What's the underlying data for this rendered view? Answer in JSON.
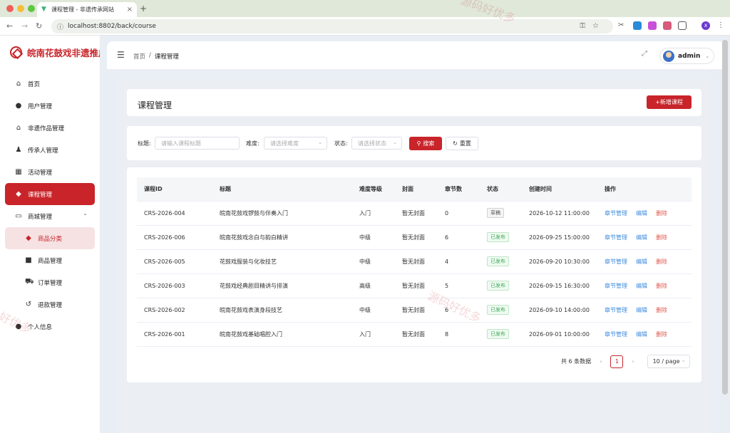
{
  "browser": {
    "tab_title": "课程管理 - 非遗传承网站",
    "new_tab": "+",
    "tab_close": "×",
    "url": "localhost:8802/back/course",
    "profile_initial": "x"
  },
  "sidebar": {
    "logo_text": "皖南花鼓戏非遗推广",
    "items": [
      {
        "label": "首页",
        "icon": "home-icon"
      },
      {
        "label": "用户管理",
        "icon": "user-icon"
      },
      {
        "label": "非遗作品管理",
        "icon": "bank-icon"
      },
      {
        "label": "传承人管理",
        "icon": "inheritor-icon"
      },
      {
        "label": "活动管理",
        "icon": "calendar-icon"
      },
      {
        "label": "课程管理",
        "icon": "graduation-cap-icon"
      },
      {
        "label": "商城管理",
        "icon": "shop-icon"
      }
    ],
    "sub_items": [
      {
        "label": "商品分类",
        "icon": "tag-icon"
      },
      {
        "label": "商品管理",
        "icon": "bag-icon"
      },
      {
        "label": "订单管理",
        "icon": "cart-icon"
      },
      {
        "label": "退款管理",
        "icon": "refund-icon"
      }
    ],
    "last_item": {
      "label": "个人信息",
      "icon": "profile-icon"
    }
  },
  "header": {
    "breadcrumb_home": "首页",
    "breadcrumb_sep": "/",
    "breadcrumb_current": "课程管理",
    "username": "admin"
  },
  "page": {
    "title": "课程管理",
    "add_button": "+新增课程"
  },
  "filters": {
    "title_label": "标题:",
    "title_placeholder": "请输入课程标题",
    "difficulty_label": "难度:",
    "difficulty_placeholder": "请选择难度",
    "status_label": "状态:",
    "status_placeholder": "请选择状态",
    "search_button": "搜索",
    "reset_button": "重置"
  },
  "table": {
    "headers": [
      "课程ID",
      "标题",
      "难度等级",
      "封面",
      "章节数",
      "状态",
      "创建时间",
      "操作"
    ],
    "rows": [
      {
        "id": "CRS-2026-004",
        "title": "皖南花鼓戏锣鼓与伴奏入门",
        "level": "入门",
        "cover": "暂无封面",
        "chapters": "0",
        "status": "草稿",
        "created": "2026-10-12 11:00:00"
      },
      {
        "id": "CRS-2026-006",
        "title": "皖南花鼓戏念白与韵白精讲",
        "level": "中级",
        "cover": "暂无封面",
        "chapters": "6",
        "status": "已发布",
        "created": "2026-09-25 15:00:00"
      },
      {
        "id": "CRS-2026-005",
        "title": "花鼓戏服装与化妆技艺",
        "level": "中级",
        "cover": "暂无封面",
        "chapters": "4",
        "status": "已发布",
        "created": "2026-09-20 10:30:00"
      },
      {
        "id": "CRS-2026-003",
        "title": "花鼓戏经典剧目精讲与排演",
        "level": "高级",
        "cover": "暂无封面",
        "chapters": "5",
        "status": "已发布",
        "created": "2026-09-15 16:30:00"
      },
      {
        "id": "CRS-2026-002",
        "title": "皖南花鼓戏表演身段技艺",
        "level": "中级",
        "cover": "暂无封面",
        "chapters": "6",
        "status": "已发布",
        "created": "2026-09-10 14:00:00"
      },
      {
        "id": "CRS-2026-001",
        "title": "皖南花鼓戏基础唱腔入门",
        "level": "入门",
        "cover": "暂无封面",
        "chapters": "8",
        "status": "已发布",
        "created": "2026-09-01 10:00:00"
      }
    ],
    "actions": {
      "chapters": "章节管理",
      "edit": "编辑",
      "delete": "删除"
    }
  },
  "pagination": {
    "total": "共 6 条数据",
    "current_page": "1",
    "page_size": "10 / page"
  },
  "watermarks": [
    "源码好优多",
    "源码好优多",
    "好优多"
  ],
  "colors": {
    "brand": "#c8242a",
    "link": "#3f8cde",
    "danger": "#e0584f",
    "success": "#3fa955"
  }
}
